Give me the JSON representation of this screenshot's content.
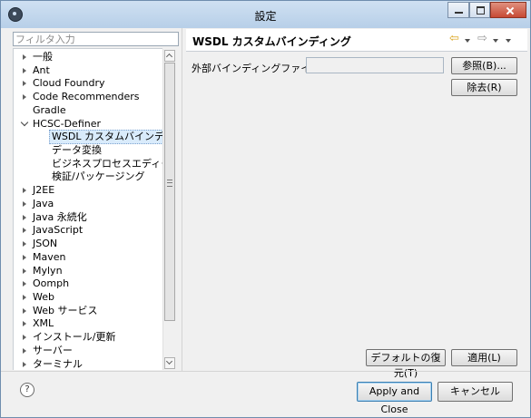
{
  "window": {
    "title": "設定"
  },
  "filter": {
    "placeholder": "フィルタ入力"
  },
  "tree": {
    "items": [
      {
        "label": "一般",
        "state": "collapsed",
        "level": 0
      },
      {
        "label": "Ant",
        "state": "collapsed",
        "level": 0
      },
      {
        "label": "Cloud Foundry",
        "state": "collapsed",
        "level": 0
      },
      {
        "label": "Code Recommenders",
        "state": "collapsed",
        "level": 0
      },
      {
        "label": "Gradle",
        "state": "leaf",
        "level": 0
      },
      {
        "label": "HCSC-Definer",
        "state": "expanded",
        "level": 0
      },
      {
        "label": "WSDL カスタムバインディング",
        "state": "leaf",
        "level": 1,
        "selected": true
      },
      {
        "label": "データ変換",
        "state": "leaf",
        "level": 1
      },
      {
        "label": "ビジネスプロセスエディタ",
        "state": "leaf",
        "level": 1
      },
      {
        "label": "検証/パッケージング",
        "state": "leaf",
        "level": 1
      },
      {
        "label": "J2EE",
        "state": "collapsed",
        "level": 0
      },
      {
        "label": "Java",
        "state": "collapsed",
        "level": 0
      },
      {
        "label": "Java 永続化",
        "state": "collapsed",
        "level": 0
      },
      {
        "label": "JavaScript",
        "state": "collapsed",
        "level": 0
      },
      {
        "label": "JSON",
        "state": "collapsed",
        "level": 0
      },
      {
        "label": "Maven",
        "state": "collapsed",
        "level": 0
      },
      {
        "label": "Mylyn",
        "state": "collapsed",
        "level": 0
      },
      {
        "label": "Oomph",
        "state": "collapsed",
        "level": 0
      },
      {
        "label": "Web",
        "state": "collapsed",
        "level": 0
      },
      {
        "label": "Web サービス",
        "state": "collapsed",
        "level": 0
      },
      {
        "label": "XML",
        "state": "collapsed",
        "level": 0
      },
      {
        "label": "インストール/更新",
        "state": "collapsed",
        "level": 0
      },
      {
        "label": "サーバー",
        "state": "collapsed",
        "level": 0
      },
      {
        "label": "ターミナル",
        "state": "collapsed",
        "level": 0
      }
    ]
  },
  "page": {
    "title": "WSDL カスタムバインディング",
    "field_label": "外部バインディングファイル(E):",
    "field_value": "",
    "browse_button": "参照(B)...",
    "remove_button": "除去(R)",
    "restore_defaults_button": "デフォルトの復元(T)",
    "apply_button": "適用(L)"
  },
  "footer": {
    "apply_close_button": "Apply and Close",
    "cancel_button": "キャンセル"
  },
  "icons": {
    "back": "back-arrow-icon",
    "forward": "forward-arrow-icon",
    "help": "help-icon"
  }
}
